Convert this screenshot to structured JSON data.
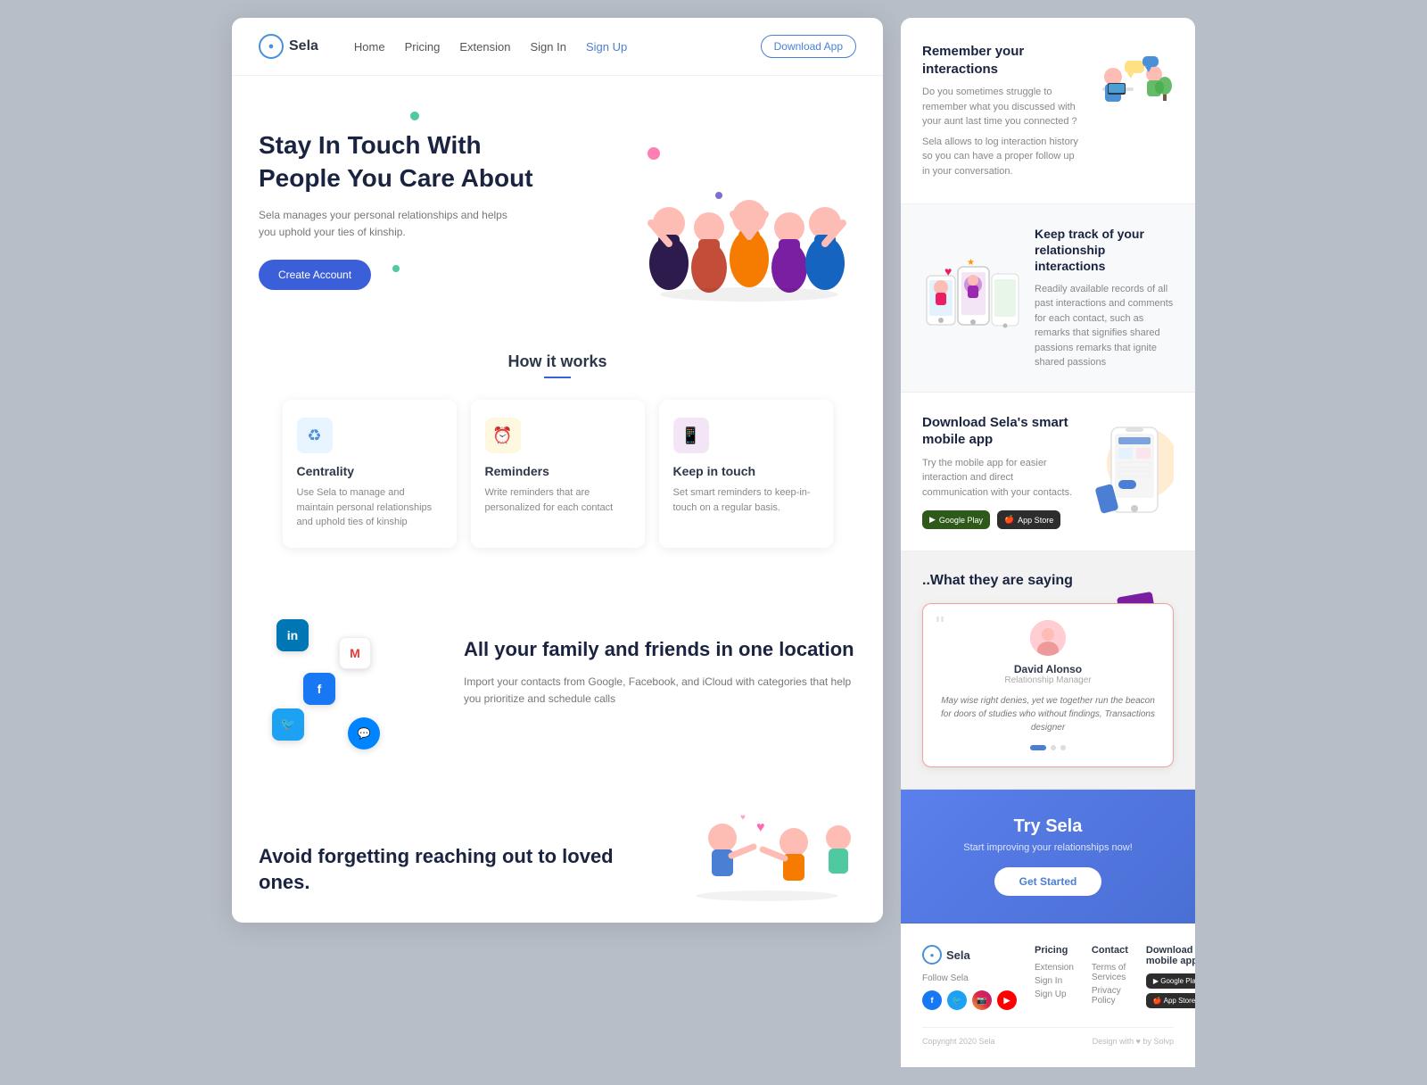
{
  "app": {
    "name": "Sela",
    "tagline": "Stay In Touch With People You Care About",
    "description": "Sela manages your personal relationships and helps you uphold your ties of kinship."
  },
  "nav": {
    "logo": "Sela",
    "links": [
      "Home",
      "Pricing",
      "Extension",
      "Sign In",
      "Sign Up"
    ],
    "cta": "Download App"
  },
  "hero": {
    "title": "Stay In Touch With People You Care About",
    "description": "Sela manages your personal relationships and helps you uphold your ties of kinship.",
    "cta": "Create Account"
  },
  "how_it_works": {
    "title": "How it works",
    "cards": [
      {
        "title": "Centrality",
        "description": "Use Sela to manage and maintain personal relationships and uphold ties of kinship",
        "icon": "♻"
      },
      {
        "title": "Reminders",
        "description": "Write reminders that are personalized for each contact",
        "icon": "⏰"
      },
      {
        "title": "Keep in touch",
        "description": "Set smart reminders to keep-in-touch on a regular basis.",
        "icon": "📱"
      }
    ]
  },
  "contacts_section": {
    "title": "All your family and friends in one location",
    "description": "Import your contacts from Google, Facebook, and iCloud with categories that help you prioritize and schedule calls"
  },
  "avoid_section": {
    "title": "Avoid forgetting reaching out to loved ones."
  },
  "remember_section": {
    "title": "Remember your interactions",
    "description1": "Do you sometimes struggle to remember what you discussed with your aunt last time you connected ?",
    "description2": "Sela allows to log interaction history so you can have a proper follow up in your conversation."
  },
  "track_section": {
    "title": "Keep track of your relationship interactions",
    "description": "Readily available records of all past interactions and comments for each contact, such as remarks that signifies shared passions remarks that ignite shared passions"
  },
  "download_section": {
    "title": "Download Sela's smart mobile app",
    "description": "Try the mobile app for easier interaction and direct communication with your contacts.",
    "google_play": "Google Play",
    "app_store": "App Store"
  },
  "testimonial_section": {
    "title": "..What they are saying",
    "testimonial": {
      "name": "David Alonso",
      "role": "Relationship Manager",
      "text": "May wise right denies, yet we together run the beacon for doors of studies who without findings, Transactions designer"
    }
  },
  "try_section": {
    "title": "Try Sela",
    "description": "Start improving your relationships now!",
    "cta": "Get Started"
  },
  "footer": {
    "logo": "Sela",
    "follow_label": "Follow Sela",
    "columns": [
      {
        "title": "Pricing",
        "links": [
          "Extension",
          "Sign In",
          "Sign Up"
        ]
      },
      {
        "title": "Contact",
        "links": [
          "Terms of Services",
          "Privacy Policy"
        ]
      }
    ],
    "download_label": "Download our mobile app",
    "copyright": "Copyright 2020 Sela",
    "credit": "Design with ♥ by Solvp"
  }
}
